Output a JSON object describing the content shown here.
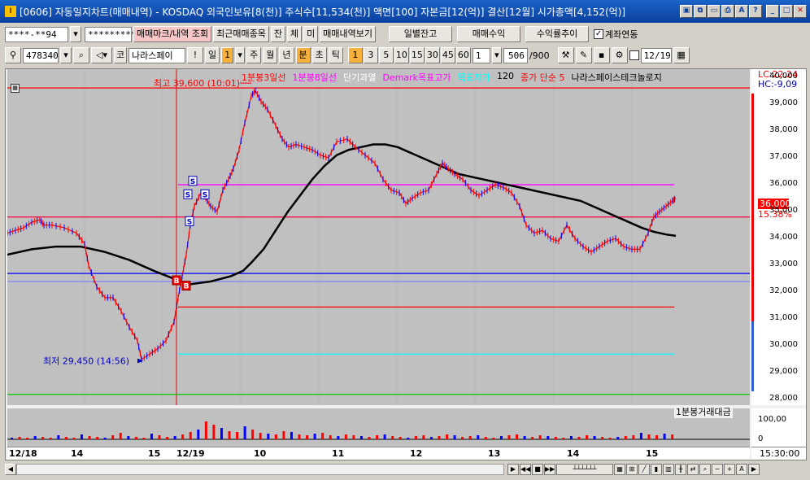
{
  "window": {
    "title": "[0606] 자동일지차트(매매내역) - KOSDAQ 외국인보유[8(천)] 주식수[11,534(천)] 액면[100] 자본금[12(억)] 결산[12월] 시가총액[4,152(억)]",
    "app_icon": "I",
    "controls": [
      "restore-icon",
      "copy-icon",
      "window-icon",
      "print-icon",
      "font-icon",
      "help-icon",
      "minimize-icon",
      "maximize-icon",
      "close-icon"
    ]
  },
  "toolbar1": {
    "account": "****-**94",
    "password": "*********",
    "mark_button": "매매마크/내역 조회",
    "recent_button": "최근매매종목",
    "tab_jan": "잔",
    "tab_che": "체",
    "tab_mi": "미",
    "history_button": "매매내역보기",
    "daily_balance": "일별잔고",
    "trade_profit": "매매수익",
    "return_trend": "수익률추이",
    "account_link": "계좌연동",
    "account_link_checked": true
  },
  "toolbar2": {
    "code": "478340",
    "market_prefix": "코",
    "stock_name": "나라스페이",
    "exclaim": "!",
    "period_day": "일",
    "period_day_num": "1",
    "period_week": "주",
    "period_month": "월",
    "period_year": "년",
    "period_minute": "분",
    "period_second": "초",
    "period_tick": "틱",
    "intervals": [
      "1",
      "3",
      "5",
      "10",
      "15",
      "30",
      "45",
      "60"
    ],
    "interval_selected": "1",
    "custom_interval": "1",
    "count": "506",
    "count_max": "/900",
    "date": "12/19"
  },
  "chart": {
    "legend": [
      "1분봉3일선",
      "1분봉8일선",
      "단기과열",
      "Demark목표고가",
      "목표저가",
      "120",
      "종가 단순 5",
      "나라스페이스테크놀로지"
    ],
    "legend_colors": [
      "#ff0000",
      "#ff00ff",
      "#ffffff",
      "#ff00ff",
      "#00ffff",
      "#000000",
      "#ff0000",
      "#000000"
    ],
    "lc": "LC:22,24",
    "hc": "HC:-9,09",
    "high_label": "최고 39,600 (10:01)",
    "low_label": "최저 29,450 (14:56)",
    "current_price": "36,000",
    "current_pct": "15.38%",
    "y_ticks": [
      "40,000",
      "39,000",
      "38,000",
      "37,000",
      "36,000",
      "35,000",
      "34,000",
      "33,000",
      "32,000",
      "31,000",
      "30,000",
      "29,000",
      "28,000"
    ],
    "volume_title": "1분봉거래대금",
    "volume_tick": "100,00",
    "volume_tick2": "0",
    "x_labels": [
      "12/18",
      "14",
      "15",
      "12/19",
      "10",
      "11",
      "12",
      "13",
      "14",
      "15"
    ],
    "time_label": "15:30:00",
    "buy_marker": "B",
    "sell_marker": "S"
  },
  "chart_data": {
    "type": "line",
    "title": "나라스페이스테크놀로지 1분봉",
    "ylim": [
      27800,
      40300
    ],
    "y_ticks": [
      40000,
      39000,
      38000,
      37000,
      36000,
      35000,
      34000,
      33000,
      32000,
      31000,
      30000,
      29000,
      28000
    ],
    "series": [
      {
        "name": "price",
        "color": "#ff0000",
        "points": [
          [
            0,
            34200
          ],
          [
            10,
            34300
          ],
          [
            20,
            34400
          ],
          [
            30,
            34600
          ],
          [
            40,
            34700
          ],
          [
            45,
            34500
          ],
          [
            55,
            34500
          ],
          [
            70,
            34400
          ],
          [
            85,
            34200
          ],
          [
            95,
            33800
          ],
          [
            100,
            33000
          ],
          [
            110,
            32200
          ],
          [
            120,
            31800
          ],
          [
            130,
            31800
          ],
          [
            140,
            31300
          ],
          [
            150,
            30700
          ],
          [
            160,
            30200
          ],
          [
            165,
            29500
          ],
          [
            175,
            29700
          ],
          [
            185,
            29900
          ],
          [
            195,
            30200
          ],
          [
            205,
            30900
          ],
          [
            210,
            31800
          ],
          [
            215,
            32600
          ],
          [
            220,
            33400
          ],
          [
            225,
            34500
          ],
          [
            230,
            35200
          ],
          [
            238,
            35700
          ],
          [
            244,
            35500
          ],
          [
            250,
            35200
          ],
          [
            258,
            35000
          ],
          [
            265,
            35800
          ],
          [
            272,
            36200
          ],
          [
            278,
            36600
          ],
          [
            285,
            37300
          ],
          [
            292,
            38300
          ],
          [
            300,
            39300
          ],
          [
            305,
            39500
          ],
          [
            312,
            39100
          ],
          [
            320,
            38800
          ],
          [
            330,
            38200
          ],
          [
            338,
            37700
          ],
          [
            346,
            37400
          ],
          [
            355,
            37500
          ],
          [
            365,
            37400
          ],
          [
            375,
            37300
          ],
          [
            385,
            37100
          ],
          [
            395,
            37000
          ],
          [
            405,
            37600
          ],
          [
            418,
            37700
          ],
          [
            428,
            37400
          ],
          [
            440,
            37100
          ],
          [
            452,
            36800
          ],
          [
            462,
            36200
          ],
          [
            472,
            35800
          ],
          [
            482,
            35700
          ],
          [
            490,
            35300
          ],
          [
            498,
            35500
          ],
          [
            508,
            35700
          ],
          [
            518,
            35800
          ],
          [
            528,
            36400
          ],
          [
            535,
            36800
          ],
          [
            542,
            36600
          ],
          [
            550,
            36400
          ],
          [
            560,
            36200
          ],
          [
            570,
            35800
          ],
          [
            580,
            35600
          ],
          [
            590,
            35800
          ],
          [
            600,
            36000
          ],
          [
            610,
            35900
          ],
          [
            620,
            35700
          ],
          [
            630,
            35200
          ],
          [
            638,
            34500
          ],
          [
            648,
            34200
          ],
          [
            658,
            34300
          ],
          [
            668,
            34000
          ],
          [
            678,
            33900
          ],
          [
            688,
            34500
          ],
          [
            698,
            34000
          ],
          [
            708,
            33700
          ],
          [
            718,
            33500
          ],
          [
            728,
            33700
          ],
          [
            738,
            33900
          ],
          [
            748,
            34000
          ],
          [
            758,
            33700
          ],
          [
            768,
            33600
          ],
          [
            778,
            33600
          ],
          [
            788,
            34200
          ],
          [
            795,
            34800
          ],
          [
            802,
            35000
          ],
          [
            810,
            35200
          ],
          [
            818,
            35400
          ],
          [
            822,
            35500
          ]
        ]
      },
      {
        "name": "120",
        "color": "#000000",
        "points": [
          [
            0,
            33400
          ],
          [
            30,
            33600
          ],
          [
            60,
            33700
          ],
          [
            90,
            33700
          ],
          [
            120,
            33500
          ],
          [
            150,
            33200
          ],
          [
            180,
            32800
          ],
          [
            205,
            32500
          ],
          [
            225,
            32300
          ],
          [
            250,
            32400
          ],
          [
            275,
            32600
          ],
          [
            290,
            32800
          ],
          [
            300,
            33100
          ],
          [
            315,
            33600
          ],
          [
            330,
            34300
          ],
          [
            345,
            35000
          ],
          [
            360,
            35600
          ],
          [
            375,
            36200
          ],
          [
            390,
            36700
          ],
          [
            405,
            37100
          ],
          [
            420,
            37300
          ],
          [
            435,
            37400
          ],
          [
            450,
            37500
          ],
          [
            465,
            37500
          ],
          [
            480,
            37400
          ],
          [
            495,
            37200
          ],
          [
            510,
            37000
          ],
          [
            525,
            36800
          ],
          [
            540,
            36600
          ],
          [
            555,
            36400
          ],
          [
            570,
            36300
          ],
          [
            585,
            36200
          ],
          [
            600,
            36100
          ],
          [
            615,
            36000
          ],
          [
            630,
            35900
          ],
          [
            645,
            35800
          ],
          [
            660,
            35700
          ],
          [
            675,
            35600
          ],
          [
            690,
            35500
          ],
          [
            705,
            35400
          ],
          [
            720,
            35200
          ],
          [
            735,
            35000
          ],
          [
            750,
            34800
          ],
          [
            765,
            34600
          ],
          [
            780,
            34400
          ],
          [
            795,
            34250
          ],
          [
            810,
            34150
          ],
          [
            822,
            34100
          ]
        ]
      }
    ],
    "hlines": [
      {
        "name": "최고",
        "value": 39600,
        "color": "#ff0000",
        "from": 0
      },
      {
        "name": "Demark목표고가",
        "value": 36000,
        "color": "#ff00ff",
        "from": 210
      },
      {
        "name": "종가 단순 5",
        "value": 34800,
        "color": "#ff0040",
        "from": 0
      },
      {
        "name": "1분봉8일선",
        "value": 32700,
        "color": "#0000ff",
        "from": 0
      },
      {
        "name": "1분봉3일선",
        "value": 32400,
        "color": "#8080ff",
        "from": 0
      },
      {
        "name": "단기과열",
        "value": 31450,
        "color": "#ff0000",
        "from": 210
      },
      {
        "name": "목표저가",
        "value": 29700,
        "color": "#00ffff",
        "from": 210
      },
      {
        "name": "low",
        "value": 28200,
        "color": "#00cc00",
        "from": 0
      }
    ],
    "sells": [
      [
        228,
        36100
      ],
      [
        222,
        35600
      ],
      [
        243,
        35600
      ],
      [
        224,
        34600
      ]
    ],
    "buys": [
      [
        208,
        32400
      ],
      [
        220,
        32200
      ]
    ],
    "volume": [
      2,
      3,
      2,
      4,
      3,
      2,
      5,
      3,
      2,
      6,
      4,
      3,
      2,
      5,
      8,
      4,
      3,
      2,
      7,
      5,
      3,
      4,
      6,
      9,
      12,
      22,
      18,
      14,
      10,
      9,
      16,
      12,
      8,
      7,
      6,
      10,
      9,
      6,
      5,
      7,
      8,
      5,
      4,
      6,
      5,
      4,
      3,
      5,
      6,
      4,
      3,
      2,
      4,
      5,
      3,
      4,
      6,
      5,
      3,
      4,
      5,
      3,
      2,
      4,
      5,
      6,
      4,
      3,
      5,
      4,
      3,
      2,
      4,
      3,
      5,
      4,
      3,
      2,
      3,
      4,
      5,
      8,
      6,
      5,
      7,
      6
    ]
  }
}
